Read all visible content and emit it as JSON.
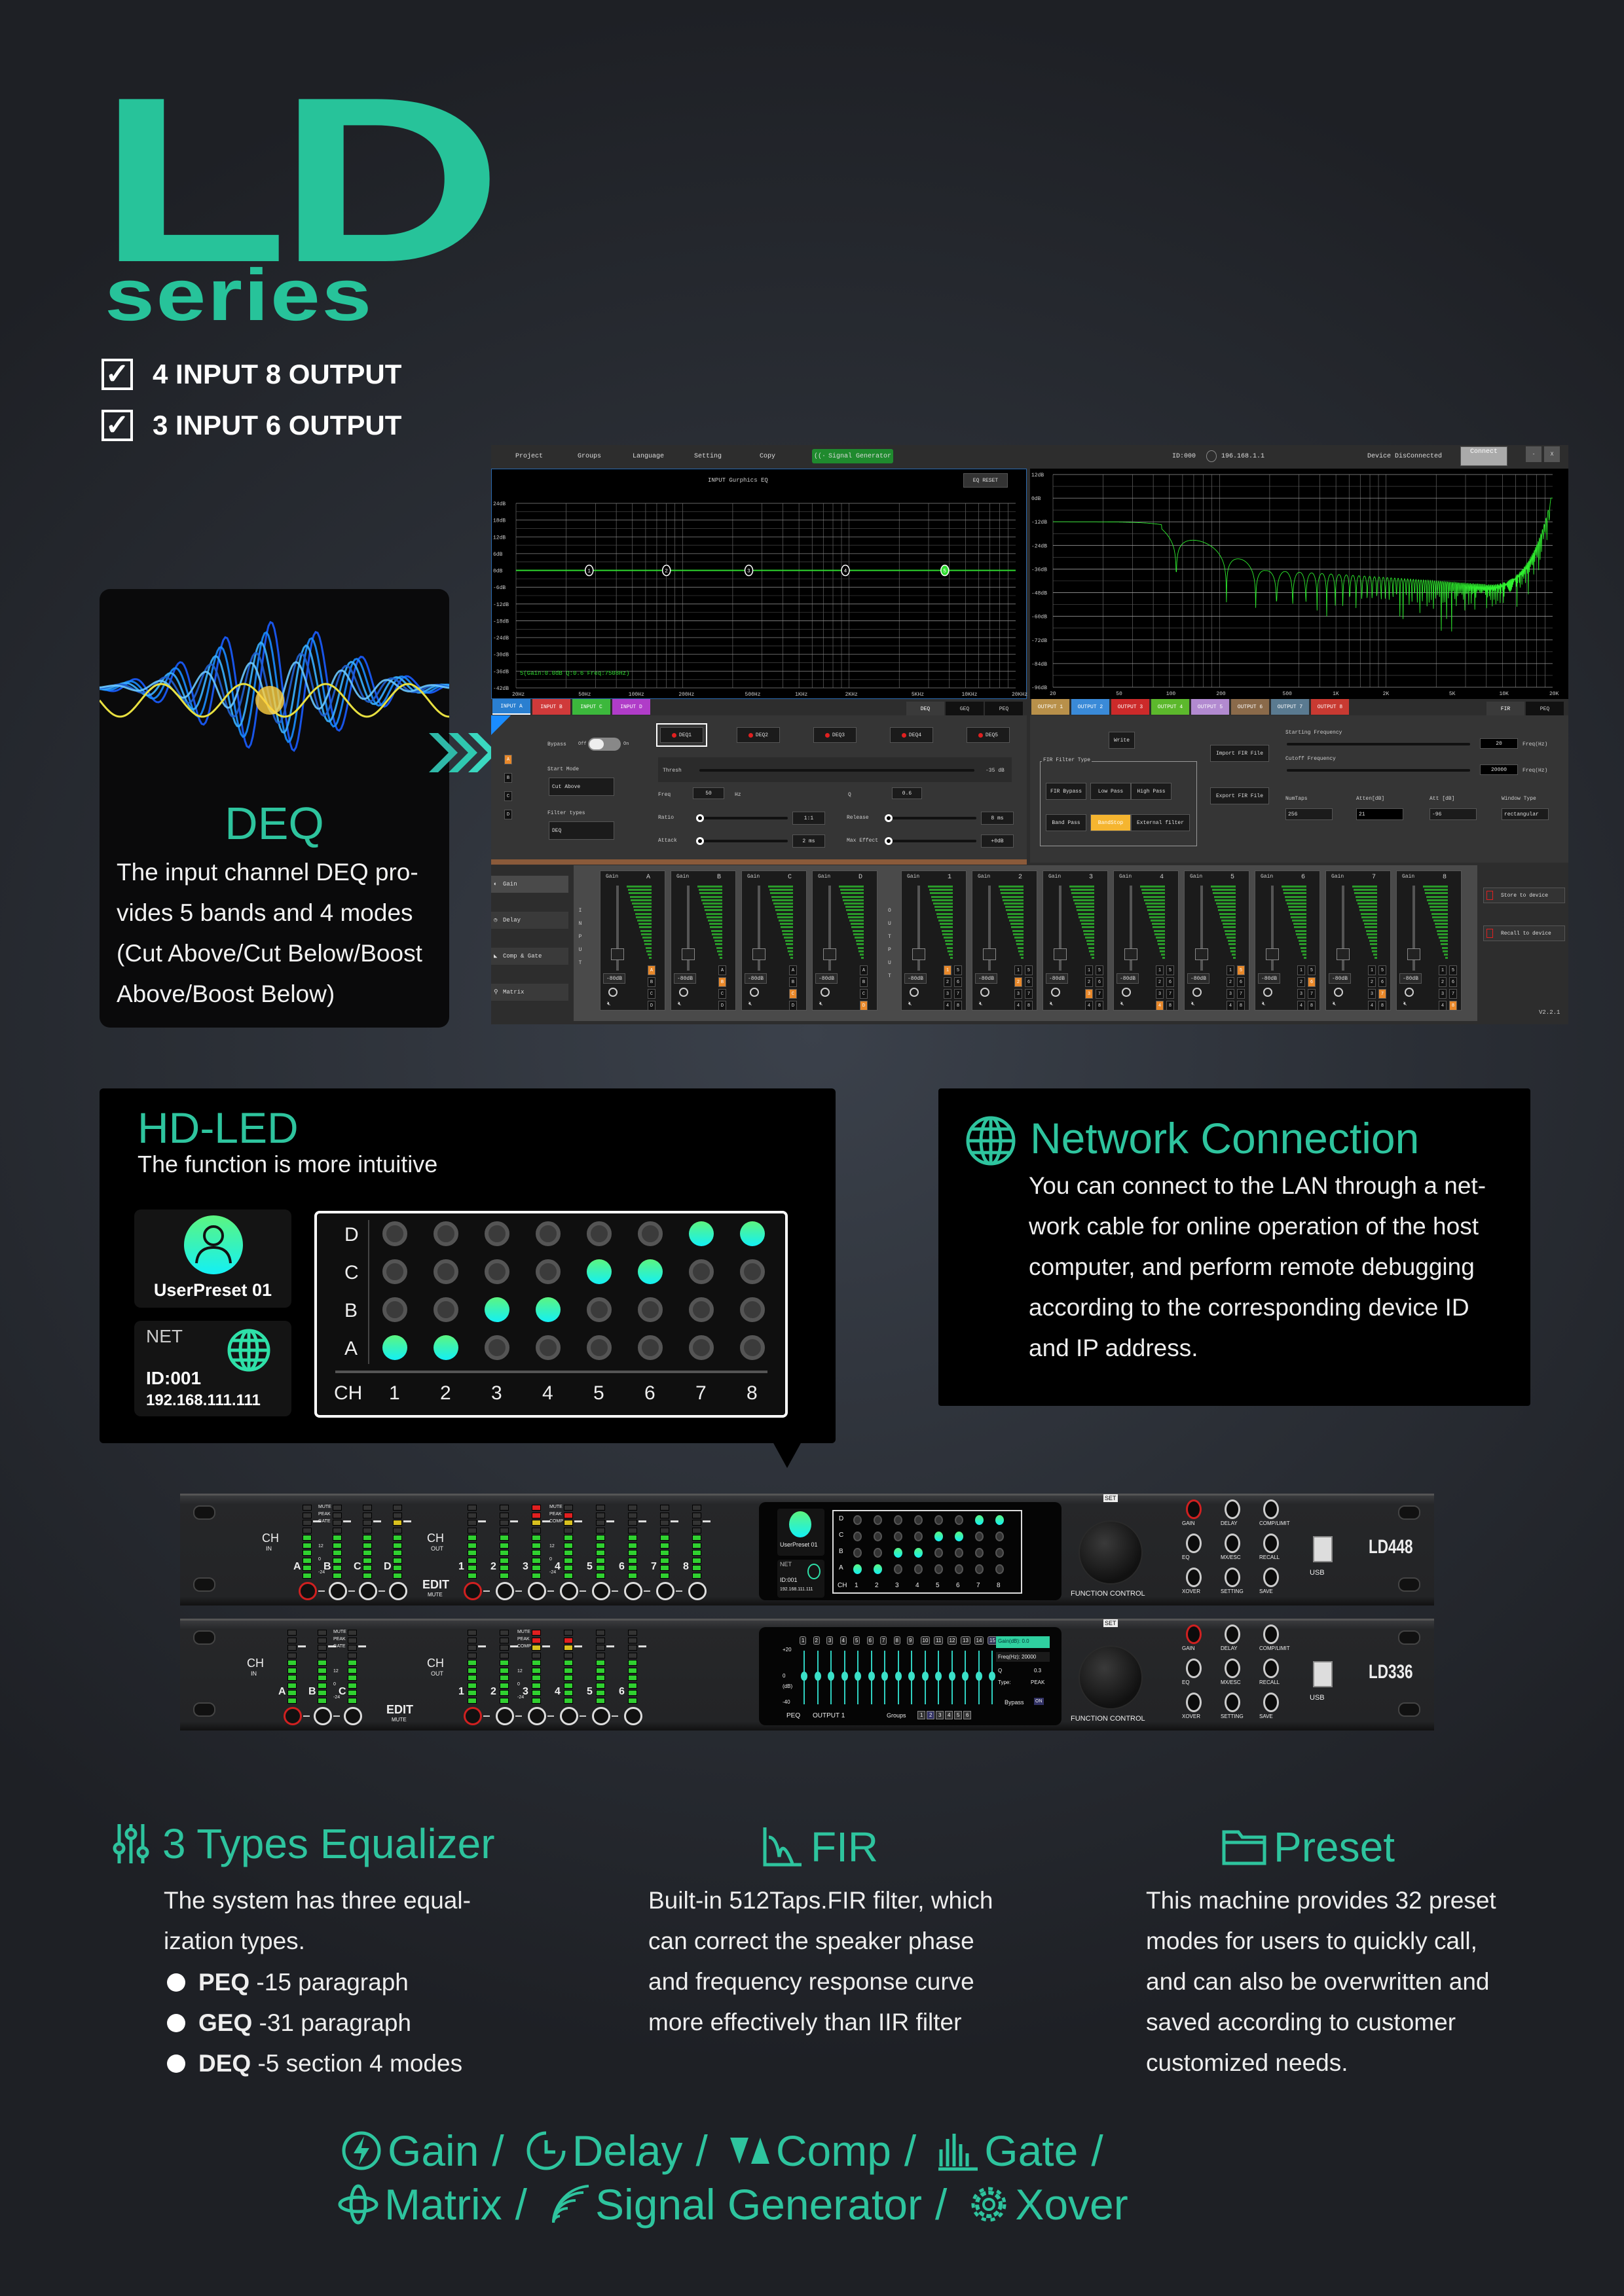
{
  "colors": {
    "accent": "#2ec49e",
    "background": "#2a2e35",
    "led_on": "#2ef0c8",
    "highlight": "#e8882a"
  },
  "brand": {
    "logo": "LD",
    "series": "series"
  },
  "specs": [
    {
      "label": "4 INPUT 8 OUTPUT",
      "checked": true
    },
    {
      "label": "3 INPUT 6 OUTPUT",
      "checked": true
    }
  ],
  "deq_card": {
    "title": "DEQ",
    "lines": [
      "The input channel DEQ pro-",
      "vides 5 bands and 4 modes",
      "(Cut Above/Cut Below/Boost",
      "Above/Boost Below)"
    ]
  },
  "software": {
    "menu": [
      "Project",
      "Groups",
      "Language",
      "Setting",
      "Copy"
    ],
    "signal_generator": "Signal Generator",
    "device_id": "ID:000",
    "ip": "196.168.1.1",
    "status": "Device DisConnected",
    "connect": "Connect",
    "minimize": "-",
    "close": "X",
    "eq": {
      "title": "INPUT Gurphics EQ",
      "reset": "EQ RESET",
      "y_ticks": [
        "24dB",
        "18dB",
        "12dB",
        "6dB",
        "0dB",
        "-6dB",
        "-12dB",
        "-18dB",
        "-24dB",
        "-30dB",
        "-36dB",
        "-42dB"
      ],
      "x_ticks": [
        "20Hz",
        "50Hz",
        "100Hz",
        "200Hz",
        "500Hz",
        "1KHz",
        "2KHz",
        "5KHz",
        "10KHz",
        "20KHz"
      ],
      "bands": [
        {
          "label": "1",
          "freq_hz": 55,
          "gain_db": 0
        },
        {
          "label": "2",
          "freq_hz": 160,
          "gain_db": 0
        },
        {
          "label": "3",
          "freq_hz": 500,
          "gain_db": 0
        },
        {
          "label": "4",
          "freq_hz": 1900,
          "gain_db": 0
        },
        {
          "label": "5",
          "freq_hz": 7508,
          "gain_db": 0,
          "selected": true
        }
      ],
      "info": "5(Gain:0.0dB Q:0.6 Freq:7508Hz)"
    },
    "fir_plot": {
      "y_ticks": [
        "12dB",
        "0dB",
        "-12dB",
        "-24dB",
        "-36dB",
        "-48dB",
        "-60dB",
        "-72dB",
        "-84dB",
        "-96dB"
      ],
      "x_ticks": [
        "20",
        "50",
        "100",
        "200",
        "500",
        "1K",
        "2K",
        "5K",
        "10K",
        "20K"
      ]
    },
    "input_tabs": [
      {
        "label": "INPUT A",
        "color": "#2a7fd0"
      },
      {
        "label": "INPUT B",
        "color": "#d03a3a"
      },
      {
        "label": "INPUT C",
        "color": "#3cb83c"
      },
      {
        "label": "INPUT D",
        "color": "#b03cc8"
      }
    ],
    "eq_tabs": [
      "DEQ",
      "GEQ",
      "PEQ"
    ],
    "output_tabs": [
      {
        "label": "OUTPUT 1",
        "color": "#b8904a"
      },
      {
        "label": "OUTPUT 2",
        "color": "#3a8ad8"
      },
      {
        "label": "OUTPUT 3",
        "color": "#cc2a2a"
      },
      {
        "label": "OUTPUT 4",
        "color": "#5cb82c"
      },
      {
        "label": "OUTPUT 5",
        "color": "#b28ad0"
      },
      {
        "label": "OUTPUT 6",
        "color": "#8a6a4a"
      },
      {
        "label": "OUTPUT 7",
        "color": "#5a7a90"
      },
      {
        "label": "OUTPUT 8",
        "color": "#c83a32"
      }
    ],
    "fir_tabs": [
      "FIR",
      "PEQ"
    ],
    "deq": {
      "channels": [
        "A",
        "B",
        "C",
        "D"
      ],
      "bypass": "Bypass",
      "off": "Off",
      "on": "On",
      "start_mode_label": "Start Mode",
      "start_mode": "Cut Above",
      "filter_types_label": "Filter types",
      "filter_type": "DEQ",
      "bands": [
        "DEQ1",
        "DEQ2",
        "DEQ3",
        "DEQ4",
        "DEQ5"
      ],
      "thresh_label": "Thresh",
      "thresh": "-35 dB",
      "freq_label": "Freq",
      "freq": "50",
      "freq_unit": "Hz",
      "q_label": "Q",
      "q": "0.6",
      "ratio_label": "Ratio",
      "ratio": "1:1",
      "release_label": "Release",
      "release": "8 ms",
      "attack_label": "Attack",
      "attack": "2 ms",
      "max_effect_label": "Max Effect",
      "max_effect": "+0dB"
    },
    "fir": {
      "write": "Write",
      "filter_type_label": "FIR Filter Type",
      "filter_types": [
        "FIR Bypass",
        "Low Pass",
        "High Pass",
        "Band Pass",
        "BandStop",
        "External filter"
      ],
      "selected": "BandStop",
      "import": "Import FIR File",
      "export": "Export FIR File",
      "start_freq_label": "Starting Frequency",
      "start_freq": "20",
      "cutoff_label": "Cutoff Frequency",
      "cutoff": "20000",
      "freq_unit": "Freq(Hz)",
      "num_taps_label": "NumTaps",
      "num_taps": "256",
      "atten_label": "Atten[dB]",
      "atten": "21",
      "att_label": "Att [dB]",
      "att": "-96",
      "window_label": "Window Type",
      "window": "rectangular"
    },
    "mixer": {
      "nav": [
        "Gain",
        "Delay",
        "Comp & Gate",
        "Matrix"
      ],
      "input_label": "INPUT",
      "output_label": "OUTPUT",
      "gain_label": "Gain",
      "inputs": [
        "A",
        "B",
        "C",
        "D"
      ],
      "outputs": [
        "1",
        "2",
        "3",
        "4",
        "5",
        "6",
        "7",
        "8"
      ],
      "level": "-80dB",
      "store": "Store to device",
      "recall": "Recall to device",
      "version": "V2.2.1"
    }
  },
  "hdled": {
    "title": "HD-LED",
    "subtitle": "The function is more intuitive",
    "preset": "UserPreset 01",
    "net": "NET",
    "id": "ID:001",
    "ip": "192.168.111.111",
    "rows": [
      "D",
      "C",
      "B",
      "A"
    ],
    "ch_label": "CH",
    "channels": [
      "1",
      "2",
      "3",
      "4",
      "5",
      "6",
      "7",
      "8"
    ],
    "active": {
      "D": [
        "7",
        "8"
      ],
      "C": [
        "5",
        "6"
      ],
      "B": [
        "3",
        "4"
      ],
      "A": [
        "1",
        "2"
      ]
    }
  },
  "network": {
    "title": "Network Connection",
    "lines": [
      "You can connect to the LAN through a net-",
      "work cable for online operation of the host",
      "computer, and perform remote debugging",
      "according to the corresponding device ID",
      "and IP address."
    ]
  },
  "device_common": {
    "ch": "CH",
    "in": "IN",
    "out": "OUT",
    "edit": "EDIT",
    "mute": "MUTE",
    "meter_in": [
      "MUTE",
      "PEAK",
      "GATE",
      "12",
      "0",
      "-24"
    ],
    "meter_out": [
      "MUTE",
      "PEAK",
      "COMP",
      "12",
      "0",
      "-24"
    ],
    "set": "SET",
    "function_control": "FUNCTION CONTROL",
    "usb": "USB",
    "buttons": [
      "GAIN",
      "DELAY",
      "COMP/LIMIT",
      "EQ",
      "MX/ESC",
      "RECALL",
      "XOVER",
      "SETTING",
      "SAVE"
    ]
  },
  "devices": [
    {
      "model": "LD448",
      "inputs": [
        "A",
        "B",
        "C",
        "D"
      ],
      "outputs": [
        "1",
        "2",
        "3",
        "4",
        "5",
        "6",
        "7",
        "8"
      ],
      "screen": {
        "preset": "UserPreset 01",
        "net": "NET",
        "id": "ID:001",
        "ip": "192.168.111.111",
        "rows": [
          "D",
          "C",
          "B",
          "A"
        ],
        "ch": "CH",
        "channels": [
          "1",
          "2",
          "3",
          "4",
          "5",
          "6",
          "7",
          "8"
        ]
      }
    },
    {
      "model": "LD336",
      "inputs": [
        "A",
        "B",
        "C"
      ],
      "outputs": [
        "1",
        "2",
        "3",
        "4",
        "5",
        "6"
      ],
      "screen": {
        "bands": [
          "1",
          "2",
          "3",
          "4",
          "5",
          "6",
          "7",
          "8",
          "9",
          "10",
          "11",
          "12",
          "13",
          "14",
          "15"
        ],
        "selected_band": "15",
        "gain": "Gain(dB): 0.0",
        "freq": "Freq(Hz): 20000",
        "q_label": "Q",
        "q": "0.3",
        "type_label": "Type:",
        "type": "PEAK",
        "y_ticks": [
          "+20",
          "0",
          "(dB)",
          "-40"
        ],
        "mode": "PEQ",
        "channel": "OUTPUT 1",
        "groups_label": "Groups",
        "groups": [
          "1",
          "2",
          "3",
          "4",
          "5",
          "6"
        ],
        "selected_group": "2",
        "bypass": "Bypass",
        "bypass_state": "ON"
      }
    }
  ],
  "features": [
    {
      "title": "3 Types Equalizer",
      "icon": "equalizer-sliders-icon",
      "lines": [
        "The system has three equal-",
        "ization types."
      ],
      "bullets": [
        {
          "name": "PEQ",
          "desc": " -15 paragraph"
        },
        {
          "name": "GEQ",
          "desc": " -31 paragraph"
        },
        {
          "name": "DEQ",
          "desc": " -5 section 4 modes"
        }
      ]
    },
    {
      "title": "FIR",
      "icon": "fir-waveform-icon",
      "lines": [
        "Built-in 512Taps.FIR filter, which",
        "can correct the speaker phase",
        "and frequency response curve",
        "more effectively than IIR filter"
      ]
    },
    {
      "title": "Preset",
      "icon": "folder-icon",
      "lines": [
        "This machine provides 32 preset",
        "modes for users to quickly call,",
        "and can also be overwritten and",
        "saved according to customer",
        "customized needs."
      ]
    }
  ],
  "functions": {
    "separator": "/",
    "row1": [
      {
        "label": "Gain",
        "icon": "lightning-icon"
      },
      {
        "label": "Delay",
        "icon": "clock-icon"
      },
      {
        "label": "Comp",
        "icon": "compressor-icon"
      },
      {
        "label": "Gate",
        "icon": "gate-bars-icon"
      }
    ],
    "row2": [
      {
        "label": "Matrix",
        "icon": "matrix-icon"
      },
      {
        "label": "Signal Generator",
        "icon": "signal-waves-icon"
      },
      {
        "label": "Xover",
        "icon": "gear-icon"
      }
    ]
  }
}
